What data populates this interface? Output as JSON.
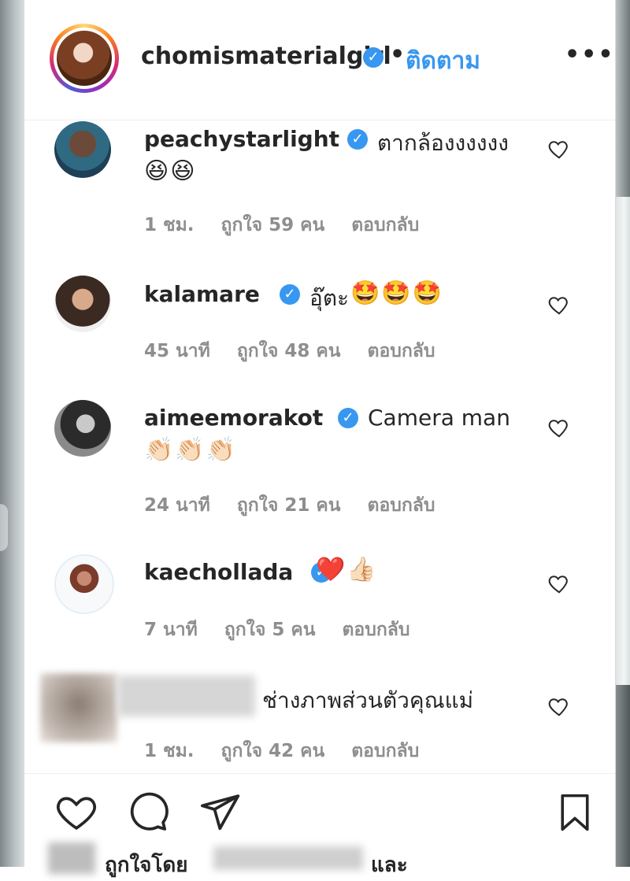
{
  "header": {
    "username": "chomismaterialgirl",
    "verified_mark": "✓",
    "separator": "•",
    "follow_label": "ติดตาม",
    "more_label": "•••",
    "avatar_icon": "profile-avatar"
  },
  "comments": [
    {
      "username": "peachystarlight",
      "text": "ตากล้องงงงงง",
      "emoji": "😆😆",
      "time": "1 ชม.",
      "likes": "ถูกใจ 59 คน",
      "reply": "ตอบกลับ"
    },
    {
      "username": "kalamare",
      "text": "อุ๊ตะ",
      "emoji": "🤩🤩🤩",
      "time": "45 นาที",
      "likes": "ถูกใจ 48 คน",
      "reply": "ตอบกลับ"
    },
    {
      "username": "aimeemorakot",
      "text": "Camera man",
      "emoji": "👏🏻👏🏻👏🏻",
      "time": "24 นาที",
      "likes": "ถูกใจ 21 คน",
      "reply": "ตอบกลับ"
    },
    {
      "username": "kaechollada",
      "text": "",
      "emoji": "❤️👍🏻",
      "time": "7 นาที",
      "likes": "ถูกใจ 5 คน",
      "reply": "ตอบกลับ"
    },
    {
      "username": "",
      "text": "ช่างภาพส่วนตัวคุณแม่",
      "emoji": "",
      "time": "1 ชม.",
      "likes": "ถูกใจ 42 คน",
      "reply": "ตอบกลับ"
    }
  ],
  "footer": {
    "liked_by": "ถูกใจโดย",
    "and": "และ"
  },
  "colors": {
    "accent": "#3897f0",
    "text": "#262626",
    "muted": "#8e8e8e",
    "heart_red": "#e0245e"
  }
}
